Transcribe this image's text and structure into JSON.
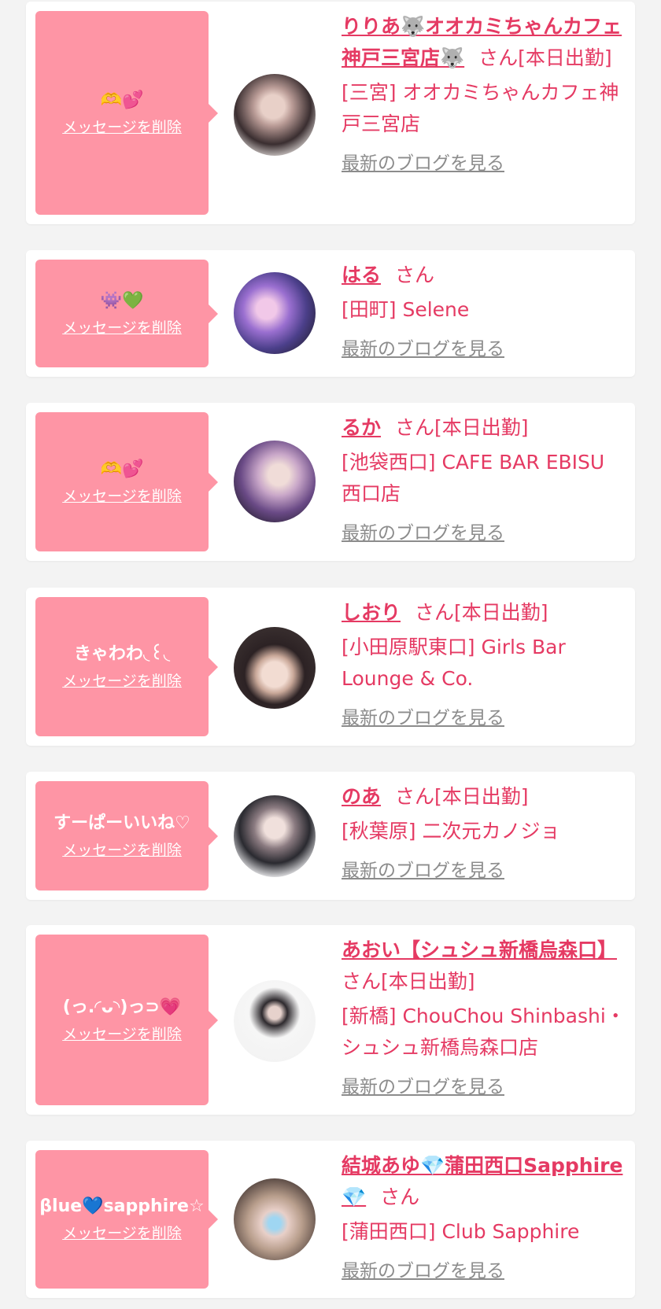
{
  "items": [
    {
      "message": "🫶💕",
      "delete_label": "メッセージを削除",
      "name": "りりあ🐺オオカミちゃんカフェ神戸三宮店🐺",
      "san": "さん[本日出勤]",
      "shop": "[三宮] オオカミちゃんカフェ神戸三宮店",
      "blog_link": "最新のブログを見る"
    },
    {
      "message": "👾💚",
      "delete_label": "メッセージを削除",
      "name": "はる",
      "san": "さん",
      "shop": "[田町] Selene",
      "blog_link": "最新のブログを見る"
    },
    {
      "message": "🫶💕",
      "delete_label": "メッセージを削除",
      "name": "るか",
      "san": "さん[本日出勤]",
      "shop": "[池袋西口] CAFE BAR EBISU 西口店",
      "blog_link": "最新のブログを見る"
    },
    {
      "message": "きゃわわ◟꒰◟",
      "delete_label": "メッセージを削除",
      "name": "しおり",
      "san": "さん[本日出勤]",
      "shop": "[小田原駅東口] Girls Bar Lounge & Co.",
      "blog_link": "最新のブログを見る"
    },
    {
      "message": "すーぱーいいね♡",
      "delete_label": "メッセージを削除",
      "name": "のあ",
      "san": "さん[本日出勤]",
      "shop": "[秋葉原] 二次元カノジョ",
      "blog_link": "最新のブログを見る"
    },
    {
      "message": "(っ.◜ᴗ◝)っ⊃💗",
      "delete_label": "メッセージを削除",
      "name": "あおい【シュシュ新橋烏森口】",
      "san": "さん[本日出勤]",
      "shop": "[新橋] ChouChou Shinbashi・シュシュ新橋烏森口店",
      "blog_link": "最新のブログを見る"
    },
    {
      "message": "βlue💙sapphire☆",
      "delete_label": "メッセージを削除",
      "name": "結城あゆ💎蒲田西口Sapphire💎",
      "san": "さん",
      "shop": "[蒲田西口] Club Sapphire",
      "blog_link": "最新のブログを見る"
    }
  ]
}
